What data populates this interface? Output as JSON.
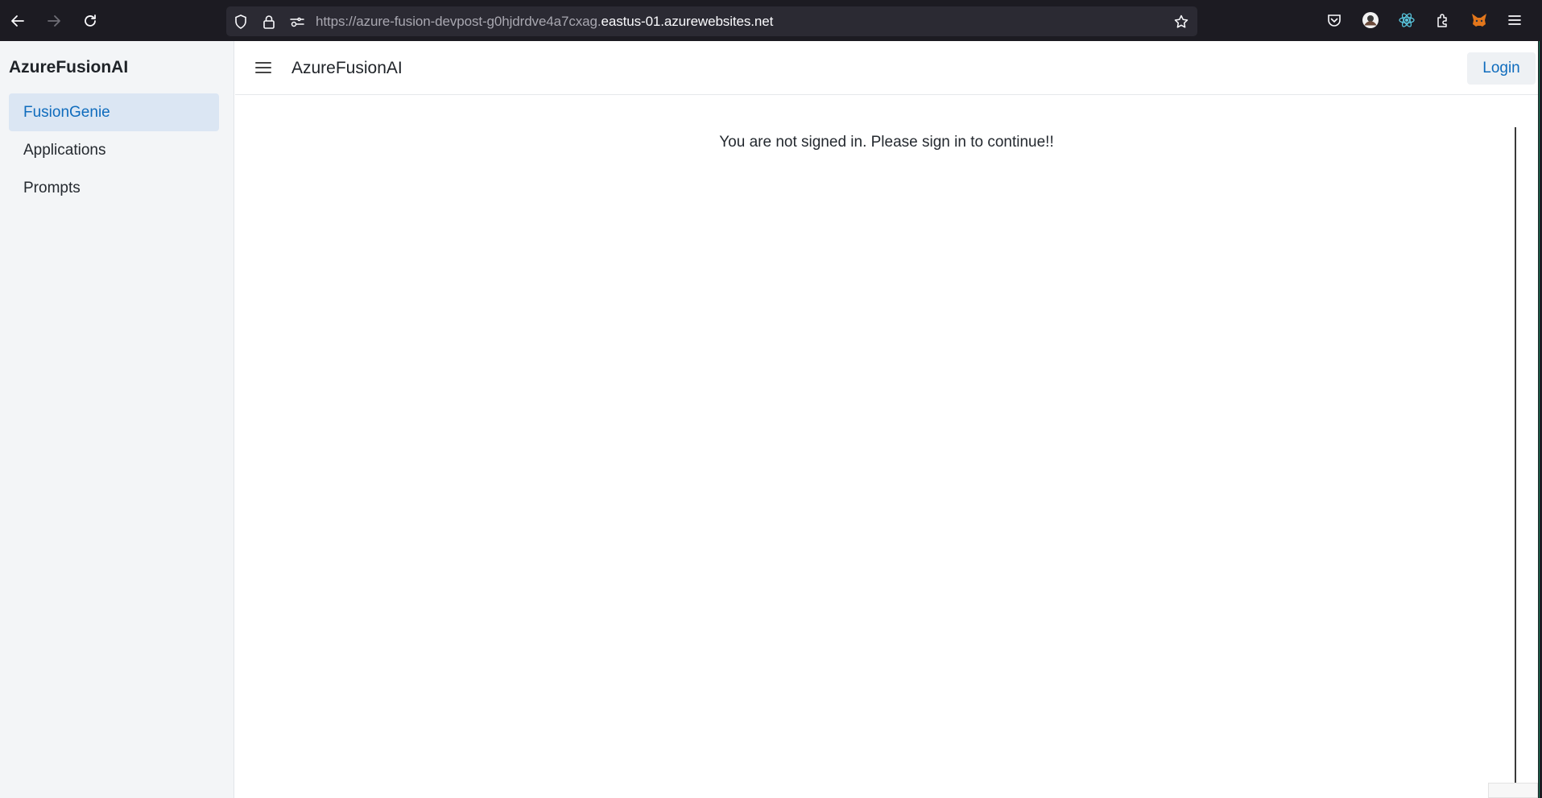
{
  "browser": {
    "url_dim": "https://azure-fusion-devpost-g0hjdrdve4a7cxag.",
    "url_main": "eastus-01.azurewebsites.net",
    "icons": [
      "back-icon",
      "forward-icon",
      "reload-icon",
      "shield-icon",
      "lock-icon",
      "permissions-icon",
      "star-icon",
      "pocket-icon",
      "account-avatar-icon",
      "react-devtools-icon",
      "extensions-icon",
      "metamask-icon",
      "menu-icon"
    ]
  },
  "sidebar": {
    "brand": "AzureFusionAI",
    "items": [
      {
        "label": "FusionGenie",
        "active": true
      },
      {
        "label": "Applications",
        "active": false
      },
      {
        "label": "Prompts",
        "active": false
      }
    ]
  },
  "header": {
    "title": "AzureFusionAI",
    "login_label": "Login"
  },
  "main": {
    "message": "You are not signed in. Please sign in to continue!!"
  },
  "colors": {
    "accent": "#0f6cbd",
    "active_bg": "#dbe6f3",
    "sidebar_bg": "#f3f5f7",
    "browser_bg": "#1c1b22"
  }
}
